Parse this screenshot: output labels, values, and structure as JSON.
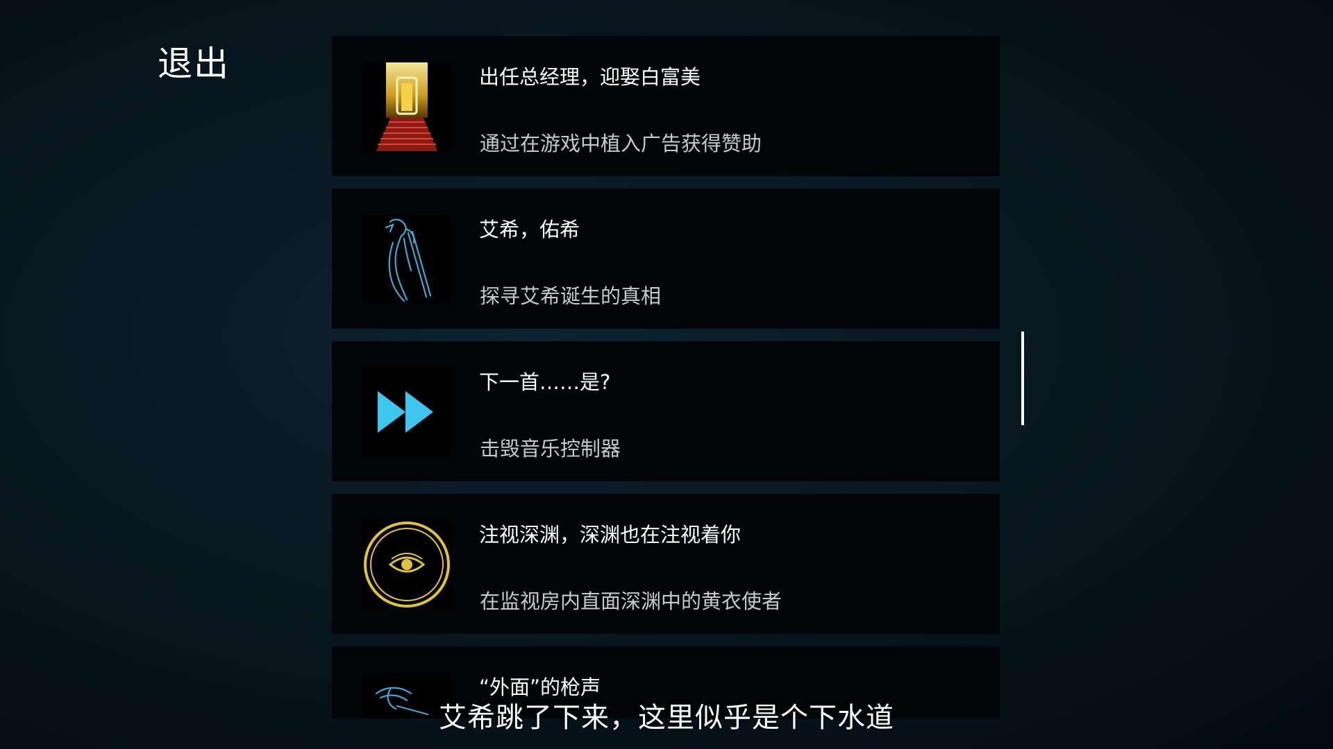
{
  "exit_label": "退出",
  "achievements": [
    {
      "icon": "red-carpet-stairs-icon",
      "title": "出任总经理，迎娶白富美",
      "description": "通过在游戏中植入广告获得赞助"
    },
    {
      "icon": "sword-figure-icon",
      "title": "艾希，佑希",
      "description": "探寻艾希诞生的真相"
    },
    {
      "icon": "fast-forward-icon",
      "title": "下一首……是?",
      "description": "击毁音乐控制器"
    },
    {
      "icon": "eye-circle-icon",
      "title": "注视深渊，深渊也在注视着你",
      "description": "在监视房内直面深渊中的黄衣使者"
    },
    {
      "icon": "gun-figure-icon",
      "title": "“外面”的枪声"
    }
  ],
  "subtitle": "艾希跳了下来，这里似乎是个下水道",
  "colors": {
    "background": "#081720",
    "card": "#020508",
    "accent_blue": "#3fc6ef",
    "accent_gold": "#e2c338",
    "accent_red": "#b3261b"
  }
}
